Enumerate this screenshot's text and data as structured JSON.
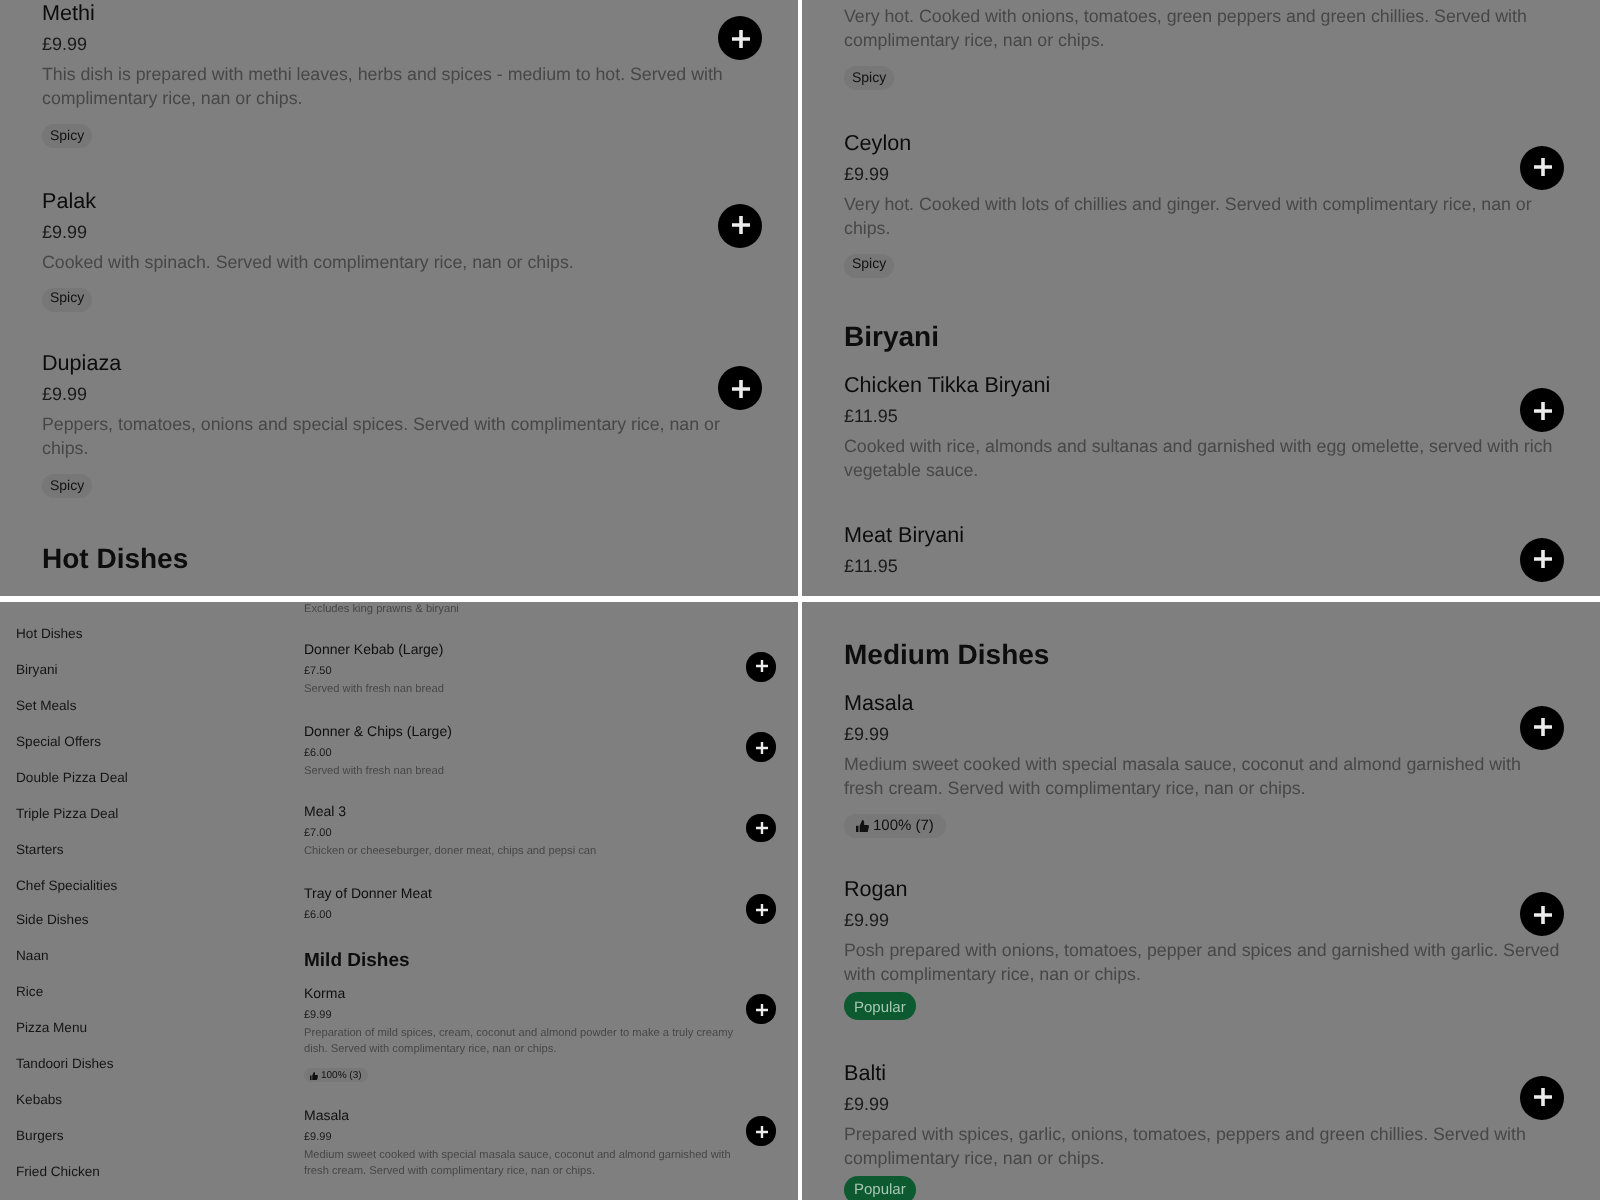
{
  "panels": [
    {
      "kind": "full",
      "sections": [
        {
          "items": [
            {
              "name": "Methi",
              "price": "£9.99",
              "description": "This dish is prepared with methi leaves, herbs and spices - medium to hot. Served with complimentary rice, nan or chips.",
              "tags": [
                {
                  "kind": "label",
                  "text": "Spicy"
                }
              ]
            },
            {
              "name": "Palak",
              "price": "£9.99",
              "description": "Cooked with spinach. Served with complimentary rice, nan or chips.",
              "tags": [
                {
                  "kind": "label",
                  "text": "Spicy"
                }
              ]
            },
            {
              "name": "Dupiaza",
              "price": "£9.99",
              "description": "Peppers, tomatoes, onions and special spices. Served with complimentary rice, nan or chips.",
              "tags": [
                {
                  "kind": "label",
                  "text": "Spicy"
                }
              ]
            }
          ]
        },
        {
          "title": "Hot Dishes"
        }
      ]
    },
    {
      "kind": "full",
      "sections": [
        {
          "items": [
            {
              "description": "Very hot. Cooked with onions, tomatoes, green peppers and green chillies. Served with complimentary rice, nan or chips.",
              "tags": [
                {
                  "kind": "label",
                  "text": "Spicy"
                }
              ]
            },
            {
              "name": "Ceylon",
              "price": "£9.99",
              "description": "Very hot. Cooked with lots of chillies and ginger. Served with complimentary rice, nan or chips.",
              "tags": [
                {
                  "kind": "label",
                  "text": "Spicy"
                }
              ]
            }
          ]
        },
        {
          "title": "Biryani",
          "items": [
            {
              "name": "Chicken Tikka Biryani",
              "price": "£11.95",
              "description": "Cooked with rice, almonds and sultanas and garnished with egg omelette, served with rich vegetable sauce."
            },
            {
              "name": "Meat Biryani",
              "price": "£11.95"
            }
          ]
        }
      ]
    },
    {
      "kind": "compact",
      "sidebar": {
        "items": [
          "Hot Dishes",
          "Biryani",
          "Set Meals",
          "Special Offers",
          "Double Pizza Deal",
          "Triple Pizza Deal",
          "Starters",
          "Chef Specialities",
          "Side Dishes",
          "Naan",
          "Rice",
          "Pizza Menu",
          "Tandoori Dishes",
          "Kebabs",
          "Burgers",
          "Fried Chicken"
        ]
      },
      "sections": [
        {
          "items": [
            {
              "description": "Excludes king prawns & biryani"
            },
            {
              "name": "Donner Kebab (Large)",
              "price": "£7.50",
              "description": "Served with fresh nan bread"
            },
            {
              "name": "Donner & Chips (Large)",
              "price": "£6.00",
              "description": "Served with fresh nan bread"
            },
            {
              "name": "Meal 3",
              "price": "£7.00",
              "description": "Chicken or cheeseburger, doner meat, chips and pepsi can"
            },
            {
              "name": "Tray of Donner Meat",
              "price": "£6.00"
            }
          ]
        },
        {
          "title": "Mild Dishes",
          "items": [
            {
              "name": "Korma",
              "price": "£9.99",
              "description": "Preparation of mild spices, cream, coconut and almond powder to make a truly creamy dish. Served with complimentary rice, nan or chips.",
              "tags": [
                {
                  "kind": "rating",
                  "text": "100% (3)"
                }
              ]
            },
            {
              "name": "Masala",
              "price": "£9.99",
              "description": "Medium sweet cooked with special masala sauce, coconut and almond garnished with fresh cream. Served with complimentary rice, nan or chips."
            }
          ]
        }
      ]
    },
    {
      "kind": "full",
      "sections": [
        {
          "title": "Medium Dishes",
          "items": [
            {
              "name": "Masala",
              "price": "£9.99",
              "description": "Medium sweet cooked with special masala sauce, coconut and almond garnished with fresh cream. Served with complimentary rice, nan or chips.",
              "tags": [
                {
                  "kind": "rating",
                  "text": "100% (7)"
                }
              ]
            },
            {
              "name": "Rogan",
              "price": "£9.99",
              "description": "Posh prepared with onions, tomatoes, pepper and spices and garnished with garlic. Served with complimentary rice, nan or chips.",
              "tags": [
                {
                  "kind": "popular",
                  "text": "Popular"
                }
              ]
            },
            {
              "name": "Balti",
              "price": "£9.99",
              "description": "Prepared with spices, garlic, onions, tomatoes, peppers and green chillies. Served with complimentary rice, nan or chips.",
              "tags": [
                {
                  "kind": "popular",
                  "text": "Popular"
                }
              ]
            }
          ]
        }
      ]
    }
  ]
}
